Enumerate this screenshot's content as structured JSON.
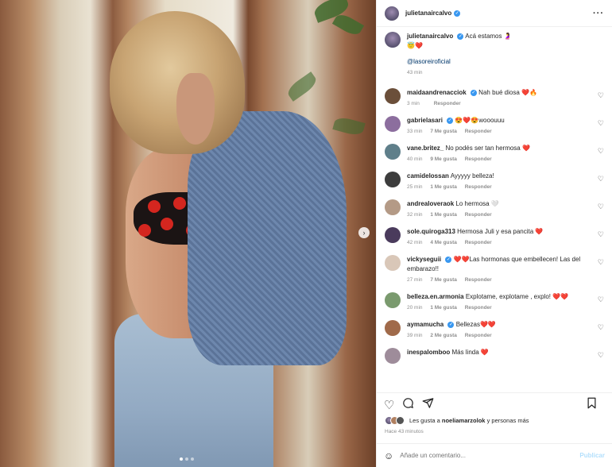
{
  "post": {
    "author": "julietanaircalvo",
    "caption_text": "Acá estamos 🤰",
    "caption_line2": "😇❤️",
    "mention": "@lasoreiroficial",
    "caption_time": "43 min"
  },
  "comments": [
    {
      "user": "maidaandrenacciok",
      "verified": true,
      "text": "Nah bué diosa ❤️🔥",
      "time": "3 min",
      "likes": "",
      "reply": "Responder"
    },
    {
      "user": "gabrielasari",
      "verified": true,
      "text": "😍❤️😍wooouuu",
      "time": "33 min",
      "likes": "7 Me gusta",
      "reply": "Responder"
    },
    {
      "user": "vane.britez_",
      "verified": false,
      "text": "No podés ser tan hermosa ❤️",
      "time": "40 min",
      "likes": "9 Me gusta",
      "reply": "Responder"
    },
    {
      "user": "camidelossan",
      "verified": false,
      "text": "Ayyyyy belleza!",
      "time": "25 min",
      "likes": "1 Me gusta",
      "reply": "Responder"
    },
    {
      "user": "andrealoveraok",
      "verified": false,
      "text": "Lo hermosa 🤍",
      "time": "32 min",
      "likes": "1 Me gusta",
      "reply": "Responder"
    },
    {
      "user": "sole.quiroga313",
      "verified": false,
      "text": "Hermosa Juli y esa pancita ❤️",
      "time": "42 min",
      "likes": "4 Me gusta",
      "reply": "Responder"
    },
    {
      "user": "vickyseguii",
      "verified": true,
      "text": "❤️❤️Las hormonas que embellecen! Las del embarazo!!",
      "time": "27 min",
      "likes": "7 Me gusta",
      "reply": "Responder"
    },
    {
      "user": "belleza.en.armonia",
      "verified": false,
      "text": "Explotame, explotame , explo! ❤️❤️",
      "time": "20 min",
      "likes": "1 Me gusta",
      "reply": "Responder"
    },
    {
      "user": "aymamucha",
      "verified": true,
      "text": "Bellezas❤️❤️",
      "time": "39 min",
      "likes": "2 Me gusta",
      "reply": "Responder"
    },
    {
      "user": "inespalomboo",
      "verified": false,
      "text": "Más linda ❤️",
      "time": "",
      "likes": "",
      "reply": ""
    }
  ],
  "likes_line": {
    "prefix": "Les gusta a ",
    "user": "noeliamarzolok",
    "suffix": " y personas más"
  },
  "post_time": "Hace 43 minutos",
  "add_comment": {
    "placeholder": "Añade un comentario...",
    "publish": "Publicar"
  },
  "colors": {
    "accent": "#3897f0",
    "like_red": "#ed4956",
    "publish_disabled": "#b2dffc"
  },
  "icons": [
    "heart-icon",
    "comment-icon",
    "share-icon",
    "bookmark-icon",
    "emoji-icon",
    "more-icon",
    "verified-icon",
    "next-icon"
  ]
}
